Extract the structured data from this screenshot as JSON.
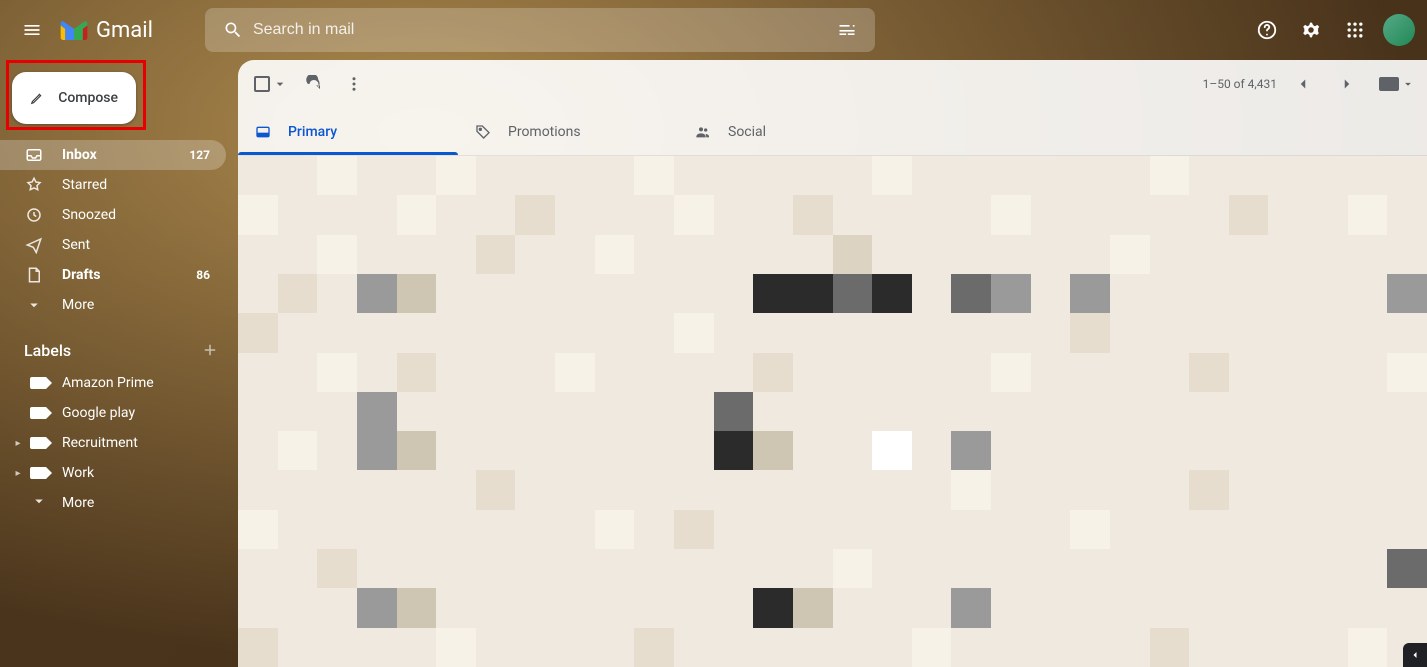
{
  "header": {
    "app_name": "Gmail",
    "search_placeholder": "Search in mail"
  },
  "sidebar": {
    "compose_label": "Compose",
    "nav": [
      {
        "label": "Inbox",
        "count": "127",
        "active": true,
        "bold": true,
        "icon": "inbox"
      },
      {
        "label": "Starred",
        "count": "",
        "active": false,
        "bold": false,
        "icon": "star"
      },
      {
        "label": "Snoozed",
        "count": "",
        "active": false,
        "bold": false,
        "icon": "clock"
      },
      {
        "label": "Sent",
        "count": "",
        "active": false,
        "bold": false,
        "icon": "send"
      },
      {
        "label": "Drafts",
        "count": "86",
        "active": false,
        "bold": true,
        "icon": "draft"
      },
      {
        "label": "More",
        "count": "",
        "active": false,
        "bold": false,
        "icon": "expand"
      }
    ],
    "labels_header": "Labels",
    "labels": [
      {
        "label": "Amazon Prime",
        "expandable": false
      },
      {
        "label": "Google play",
        "expandable": false
      },
      {
        "label": "Recruitment",
        "expandable": true
      },
      {
        "label": "Work",
        "expandable": true
      },
      {
        "label": "More",
        "expandable": false,
        "is_more": true
      }
    ]
  },
  "toolbar": {
    "page_info": "1–50 of 4,431"
  },
  "tabs": [
    {
      "label": "Primary",
      "active": true,
      "icon": "inbox-tab"
    },
    {
      "label": "Promotions",
      "active": false,
      "icon": "tag"
    },
    {
      "label": "Social",
      "active": false,
      "icon": "people"
    }
  ],
  "annotation": {
    "compose_highlighted": true
  }
}
